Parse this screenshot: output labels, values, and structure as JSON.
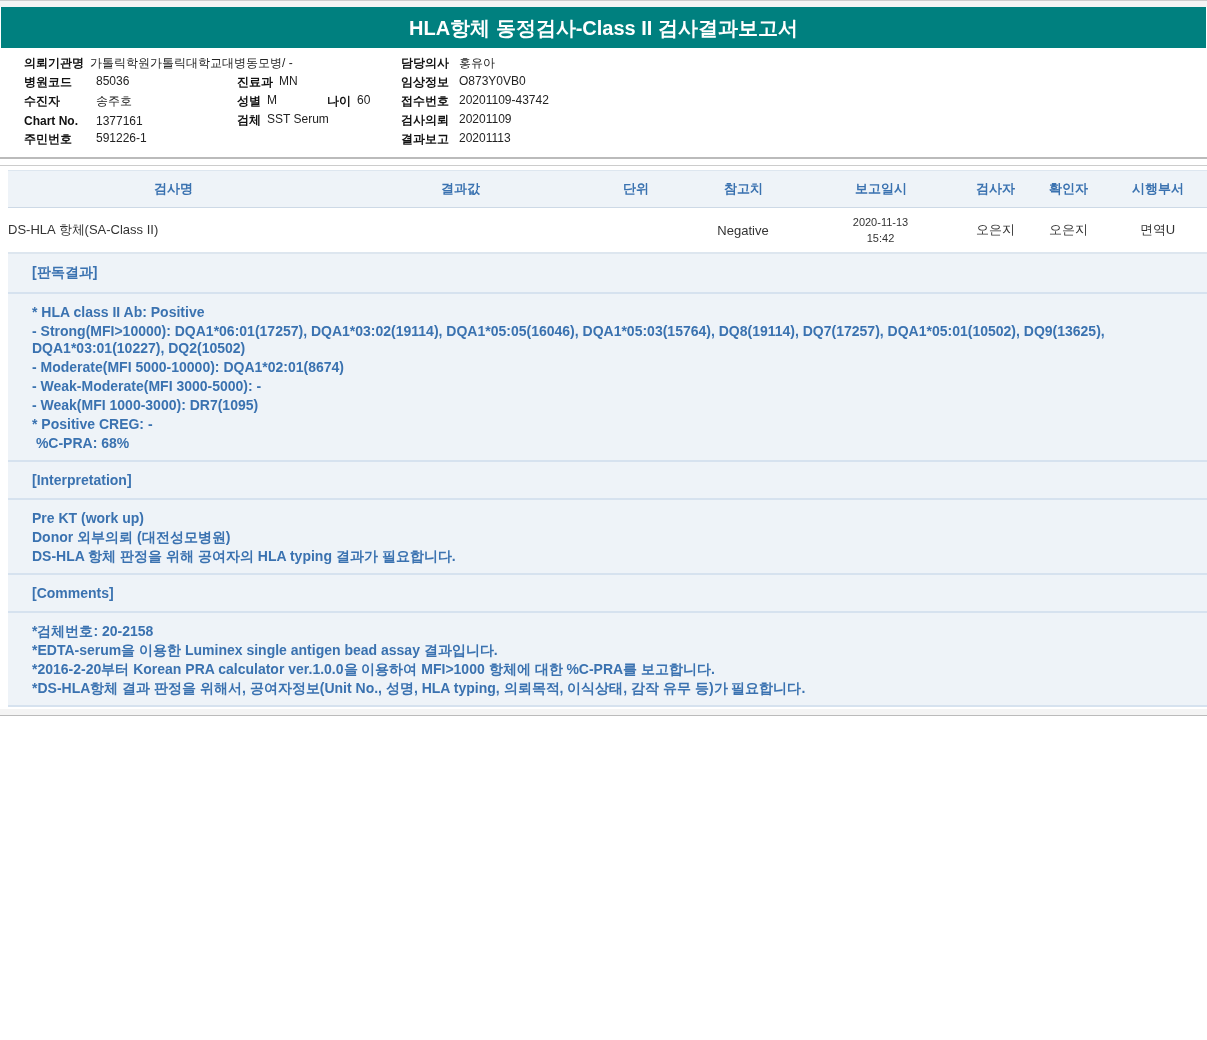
{
  "title": "HLA항체 동정검사-Class II 검사결과보고서",
  "info_rows": [
    {
      "left": {
        "label": "의뢰기관명",
        "value": "가톨릭학원가톨릭대학교대병동모병/ -"
      },
      "right": {
        "label": "담당의사",
        "value": "홍유아"
      }
    },
    {
      "left": {
        "label": "병원코드",
        "value": "85036"
      },
      "middle": [
        {
          "label": "진료과",
          "value": "MN"
        }
      ],
      "right": {
        "label": "임상정보",
        "value": "O873Y0VB0"
      }
    },
    {
      "left": {
        "label": "수진자",
        "value": "송주호"
      },
      "middle": [
        {
          "label": "성별",
          "value": "M"
        },
        {
          "label": "나이",
          "value": "60"
        }
      ],
      "right": {
        "label": "접수번호",
        "value": "20201109-43742"
      }
    },
    {
      "left": {
        "label": "Chart No.",
        "value": "1377161"
      },
      "middle": [
        {
          "label": "검체",
          "value": "SST Serum"
        }
      ],
      "right": {
        "label": "검사의뢰",
        "value": "20201109"
      }
    },
    {
      "left": {
        "label": "주민번호",
        "value": "591226-1"
      },
      "right": {
        "label": "결과보고",
        "value": "20201113"
      }
    }
  ],
  "table": {
    "columns": [
      "검사명",
      "결과값",
      "단위",
      "참고치",
      "보고일시",
      "검사자",
      "확인자",
      "시행부서"
    ],
    "rows": [
      {
        "test_name": "DS-HLA 항체(SA-Class II)",
        "reference": "Negative",
        "report_date": "2020-11-13",
        "report_time": "15:42",
        "tester": "오은지",
        "confirmer": "오은지",
        "department": "면역U"
      }
    ]
  },
  "sections": [
    {
      "heading": "[판독결과]",
      "lines": [
        "* HLA class II Ab: Positive",
        "- Strong(MFI>10000): DQA1*06:01(17257), DQA1*03:02(19114), DQA1*05:05(16046), DQA1*05:03(15764), DQ8(19114), DQ7(17257), DQA1*05:01(10502), DQ9(13625), DQA1*03:01(10227), DQ2(10502)",
        "- Moderate(MFI 5000-10000): DQA1*02:01(8674)",
        "- Weak-Moderate(MFI 3000-5000): -",
        "- Weak(MFI 1000-3000): DR7(1095)",
        "* Positive CREG: -",
        " %C-PRA: 68%"
      ]
    },
    {
      "heading": "[Interpretation]",
      "lines": [
        "Pre KT (work up)",
        "Donor 외부의뢰 (대전성모병원)",
        "DS-HLA 항체 판정을 위해 공여자의 HLA typing 결과가 필요합니다."
      ]
    },
    {
      "heading": "[Comments]",
      "lines": [
        "*검체번호: 20-2158",
        "*EDTA-serum을 이용한 Luminex single antigen bead assay 결과입니다.",
        "*2016-2-20부터 Korean PRA calculator ver.1.0.0을 이용하여 MFI>1000 항체에 대한 %C-PRA를 보고합니다.",
        "*DS-HLA항체 결과 판정을 위해서, 공여자정보(Unit No., 성명, HLA typing, 의뢰목적, 이식상태, 감작 유무 등)가 필요합니다."
      ]
    }
  ]
}
